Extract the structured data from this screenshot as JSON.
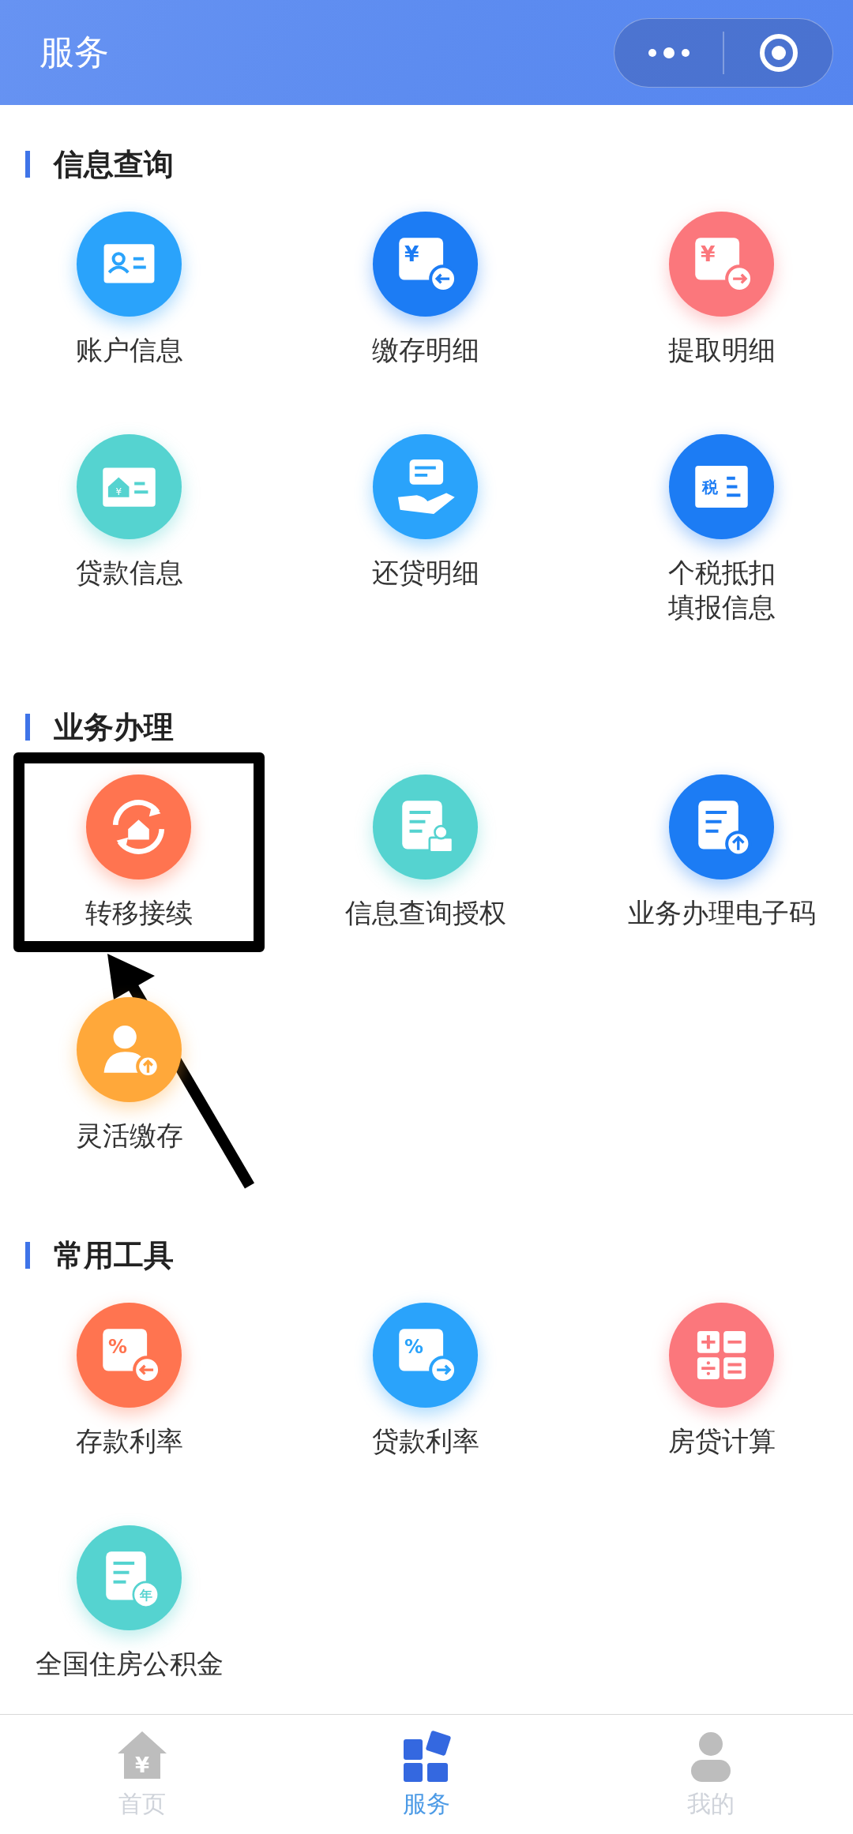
{
  "header": {
    "title": "服务"
  },
  "sections": [
    {
      "title": "信息查询",
      "items": [
        {
          "label": "账户信息",
          "kind": "card-person",
          "color": "#2aa3fb",
          "marked": false
        },
        {
          "label": "缴存明细",
          "kind": "yen-in",
          "color": "#1c7cf4",
          "glyph": "¥",
          "marked": false
        },
        {
          "label": "提取明细",
          "kind": "yen-out",
          "color": "#fb777c",
          "glyph": "¥",
          "marked": false
        },
        {
          "label": "贷款信息",
          "kind": "house-card",
          "color": "#55d3d0",
          "glyph": "¥",
          "marked": false
        },
        {
          "label": "还贷明细",
          "kind": "hand-card",
          "color": "#2aa3fb",
          "marked": false
        },
        {
          "label": "个税抵扣",
          "label_2": "填报信息",
          "kind": "tax-card",
          "color": "#1c7cf4",
          "glyph": "税",
          "marked": false
        }
      ]
    },
    {
      "title": "业务办理",
      "items": [
        {
          "label": "转移接续",
          "kind": "transfer",
          "color": "#ff7450",
          "marked": true
        },
        {
          "label": "信息查询授权",
          "kind": "doc-person",
          "color": "#55d3d0",
          "marked": false
        },
        {
          "label": "业务办理电子码",
          "kind": "doc-upload",
          "color": "#1c7cf4",
          "marked": false
        },
        {
          "label": "灵活缴存",
          "kind": "person-up",
          "color": "#ffa83a",
          "marked": false
        }
      ]
    },
    {
      "title": "常用工具",
      "items": [
        {
          "label": "存款利率",
          "kind": "percent-in",
          "color": "#ff7450",
          "glyph": "%",
          "marked": false
        },
        {
          "label": "贷款利率",
          "kind": "percent-out",
          "color": "#2aa3fb",
          "glyph": "%",
          "marked": false
        },
        {
          "label": "房贷计算",
          "kind": "calculator",
          "color": "#fb777c",
          "marked": false
        },
        {
          "label": "全国住房公积金",
          "kind": "doc-year",
          "color": "#55d3d0",
          "glyph": "年",
          "marked": false
        }
      ]
    }
  ],
  "tabbar": [
    {
      "label": "首页",
      "kind": "home",
      "glyph": "¥",
      "selected": false
    },
    {
      "label": "服务",
      "kind": "blocks",
      "selected": true
    },
    {
      "label": "我的",
      "kind": "person",
      "selected": false
    }
  ]
}
